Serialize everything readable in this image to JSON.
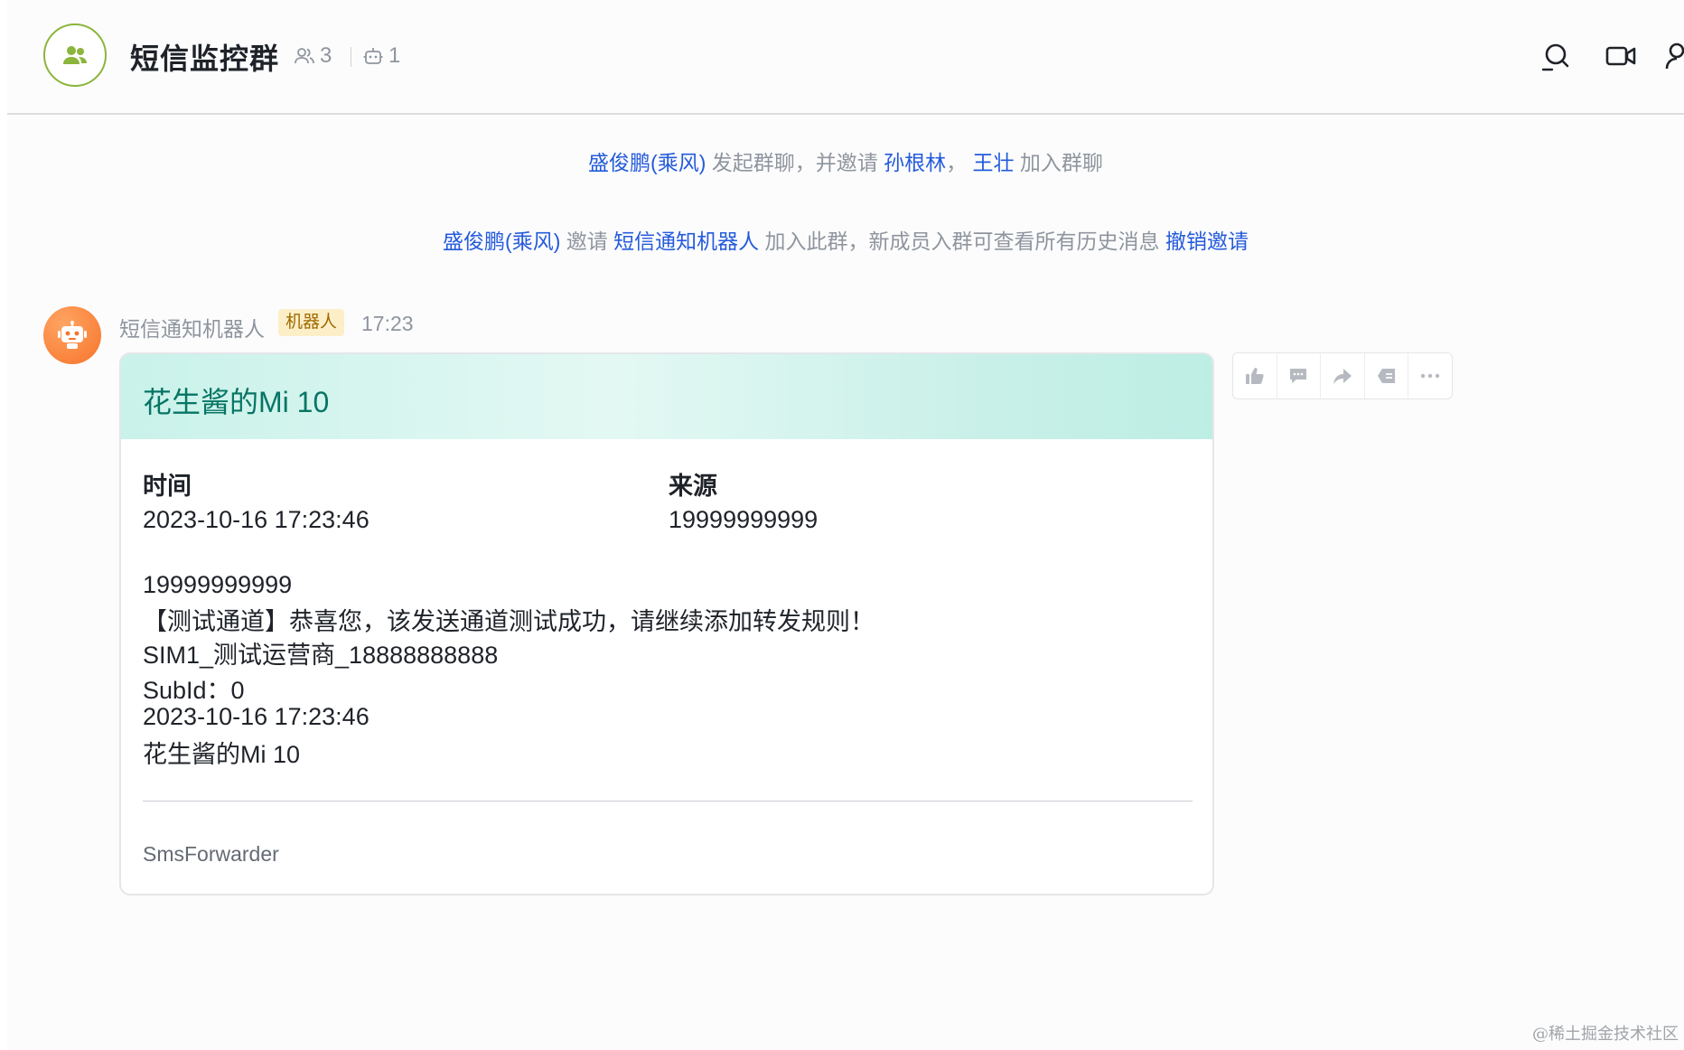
{
  "header": {
    "title": "短信监控群",
    "member_count": "3",
    "bot_count": "1",
    "icons": [
      "group-icon",
      "members-icon",
      "bot-icon",
      "search-icon",
      "video-icon",
      "add-member-icon"
    ]
  },
  "system_messages": {
    "line1": {
      "user": "盛俊鹏(乘风)",
      "text1": " 发起群聊，并邀请 ",
      "invitee1": "孙根林",
      "sep": "， ",
      "invitee2": "王壮",
      "text2": " 加入群聊"
    },
    "line2": {
      "user": "盛俊鹏(乘风)",
      "text1": " 邀请 ",
      "bot": "短信通知机器人",
      "text2": " 加入此群，新成员入群可查看所有历史消息 ",
      "revoke": "撤销邀请"
    }
  },
  "message": {
    "sender": "短信通知机器人",
    "badge": "机器人",
    "time": "17:23",
    "card": {
      "title": "花生酱的Mi 10",
      "time_label": "时间",
      "time_value": "2023-10-16 17:23:46",
      "source_label": "来源",
      "source_value": "19999999999",
      "body_lines": [
        "19999999999",
        "【测试通道】恭喜您，该发送通道测试成功，请继续添加转发规则！",
        "SIM1_测试运营商_18888888888",
        "SubId：0",
        "2023-10-16 17:23:46",
        "花生酱的Mi 10"
      ],
      "footer": "SmsForwarder"
    }
  },
  "actions": [
    "thumbs-up-icon",
    "reply-icon",
    "forward-icon",
    "pin-icon",
    "more-icon"
  ],
  "watermark": "@稀土掘金技术社区",
  "colors": {
    "link": "#245bdb",
    "accent_green": "#8bb53b",
    "card_title": "#077565",
    "bot_orange": "#f7742a"
  }
}
